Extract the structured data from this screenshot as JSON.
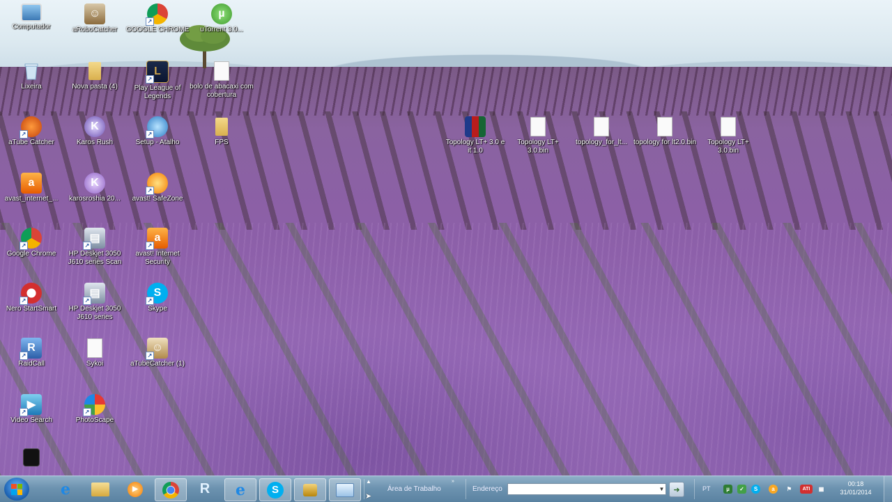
{
  "desktop": {
    "icons": [
      {
        "label": "Computador",
        "icon": "computer-icon"
      },
      {
        "label": "aRoboCatcher",
        "icon": "robot-app-icon"
      },
      {
        "label": "GOOGLE CHROME",
        "icon": "chrome-icon"
      },
      {
        "label": "uTorrent 3.0...",
        "icon": "utorrent-icon"
      },
      {
        "label": "Lixeira",
        "icon": "recycle-bin-icon"
      },
      {
        "label": "Nova pasta (4)",
        "icon": "folder-icon"
      },
      {
        "label": "Play League of Legends",
        "icon": "league-icon"
      },
      {
        "label": "bolo de abacaxi com cobertura",
        "icon": "document-icon"
      },
      {
        "label": "aTube Catcher",
        "icon": "atube-icon"
      },
      {
        "label": "Karos Rush",
        "icon": "karos-icon"
      },
      {
        "label": "Setup - Atalho",
        "icon": "setup-icon"
      },
      {
        "label": "FPS",
        "icon": "folder-icon"
      },
      {
        "label": "avast_internet_...",
        "icon": "avast-icon"
      },
      {
        "label": "karosroshia 20...",
        "icon": "karos-icon"
      },
      {
        "label": "avast! SafeZone",
        "icon": "safezone-icon"
      },
      {
        "label": "Google Chrome",
        "icon": "chrome-icon"
      },
      {
        "label": "HP Deskjet 3050 J610 series Scan",
        "icon": "printer-icon"
      },
      {
        "label": "avast! Internet Security",
        "icon": "avast-icon"
      },
      {
        "label": "Nero StartSmart",
        "icon": "nero-icon"
      },
      {
        "label": "HP Deskjet 3050 J610 series",
        "icon": "printer-icon"
      },
      {
        "label": "Skype",
        "icon": "skype-icon"
      },
      {
        "label": "RaidCall",
        "icon": "raidcall-icon"
      },
      {
        "label": "Sykoi",
        "icon": "document-icon"
      },
      {
        "label": "aTubeCatcher (1)",
        "icon": "atube-icon"
      },
      {
        "label": "Video Search",
        "icon": "video-search-icon"
      },
      {
        "label": "PhotoScape",
        "icon": "photoscape-icon"
      },
      {
        "label": "Topology LT+ 3.0 e it 1.0",
        "icon": "winrar-icon"
      },
      {
        "label": "Topology LT+ 3.0.bin",
        "icon": "document-icon"
      },
      {
        "label": "topology_for_lt...",
        "icon": "document-icon"
      },
      {
        "label": "topology for lt2.0.bin",
        "icon": "document-icon"
      },
      {
        "label": "Topology LT+ 3.0.bin",
        "icon": "document-icon"
      }
    ]
  },
  "taskbar": {
    "pinned": [
      {
        "name": "internet-explorer",
        "icon": "ie-icon",
        "glyph": "e"
      },
      {
        "name": "windows-explorer",
        "icon": "folder-icon",
        "glyph": ""
      },
      {
        "name": "media-player",
        "icon": "media-player-icon",
        "glyph": "▶"
      },
      {
        "name": "google-chrome",
        "icon": "chrome-icon",
        "glyph": ""
      },
      {
        "name": "raidcall",
        "icon": "raidcall-icon",
        "glyph": "R"
      },
      {
        "name": "internet-explorer-2",
        "icon": "ie-icon",
        "glyph": "e"
      },
      {
        "name": "skype",
        "icon": "skype-icon",
        "glyph": "S"
      },
      {
        "name": "lock-app",
        "icon": "lock-icon",
        "glyph": "🔒"
      },
      {
        "name": "window-app",
        "icon": "window-icon",
        "glyph": "▭"
      }
    ],
    "desktop_toolbar_label": "Área de Trabalho",
    "address_label": "Endereço",
    "address_value": "",
    "language": "PT",
    "clock_time": "00:18",
    "clock_date": "31/01/2014"
  },
  "colors": {
    "taskbar": "#6d93b0",
    "chrome_red": "#db4437",
    "chrome_green": "#0f9d58",
    "chrome_yellow": "#f4b400",
    "skype_blue": "#00aff0",
    "ie_blue": "#1e88e5"
  }
}
